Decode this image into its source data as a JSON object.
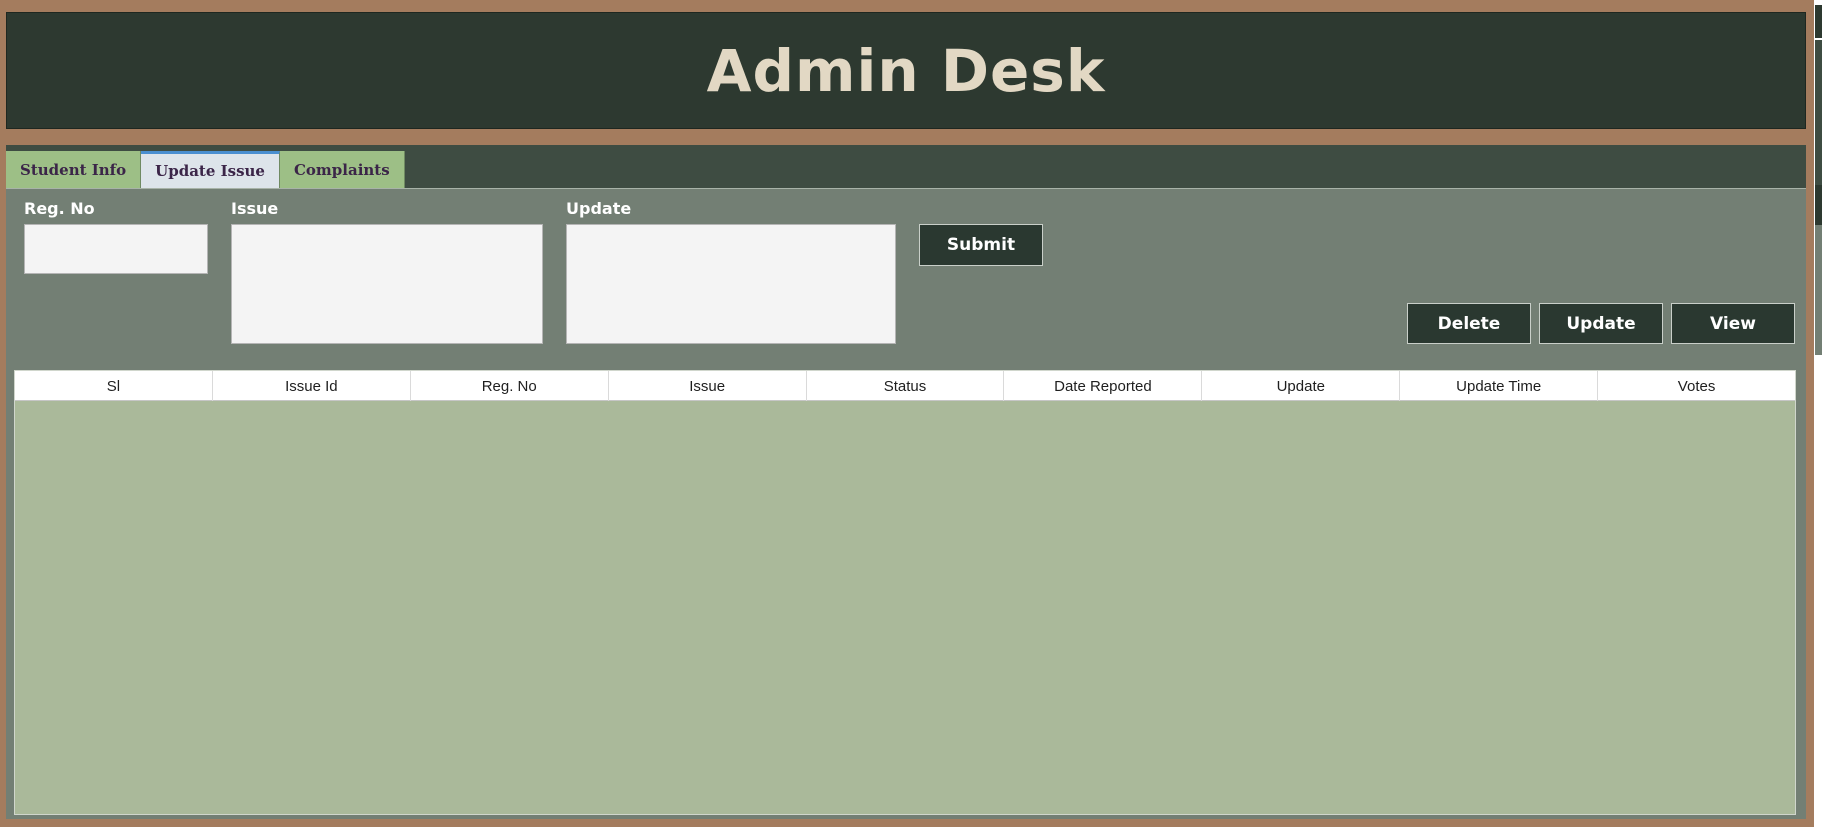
{
  "window": {
    "title": "Admin Desk"
  },
  "tabs": [
    {
      "label": "Student Info"
    },
    {
      "label": "Update Issue",
      "active": true
    },
    {
      "label": "Complaints"
    }
  ],
  "form": {
    "reg_no": {
      "label": "Reg. No",
      "value": ""
    },
    "issue": {
      "label": "Issue",
      "value": ""
    },
    "update": {
      "label": "Update",
      "value": ""
    },
    "submit_label": "Submit"
  },
  "actions": {
    "delete_label": "Delete",
    "update_label": "Update",
    "view_label": "View"
  },
  "table": {
    "columns": [
      "Sl",
      "Issue Id",
      "Reg. No",
      "Issue",
      "Status",
      "Date Reported",
      "Update",
      "Update Time",
      "Votes"
    ],
    "rows": []
  },
  "colors": {
    "frame": "#a47c5e",
    "header_bg": "#2d3930",
    "title_text": "#e2d8c4",
    "tab_bg": "#9dbf86",
    "tab_active_bg": "#dde4ea",
    "panel_bg": "#737f74",
    "table_bg": "#aab99a",
    "button_bg": "#2a3830"
  }
}
